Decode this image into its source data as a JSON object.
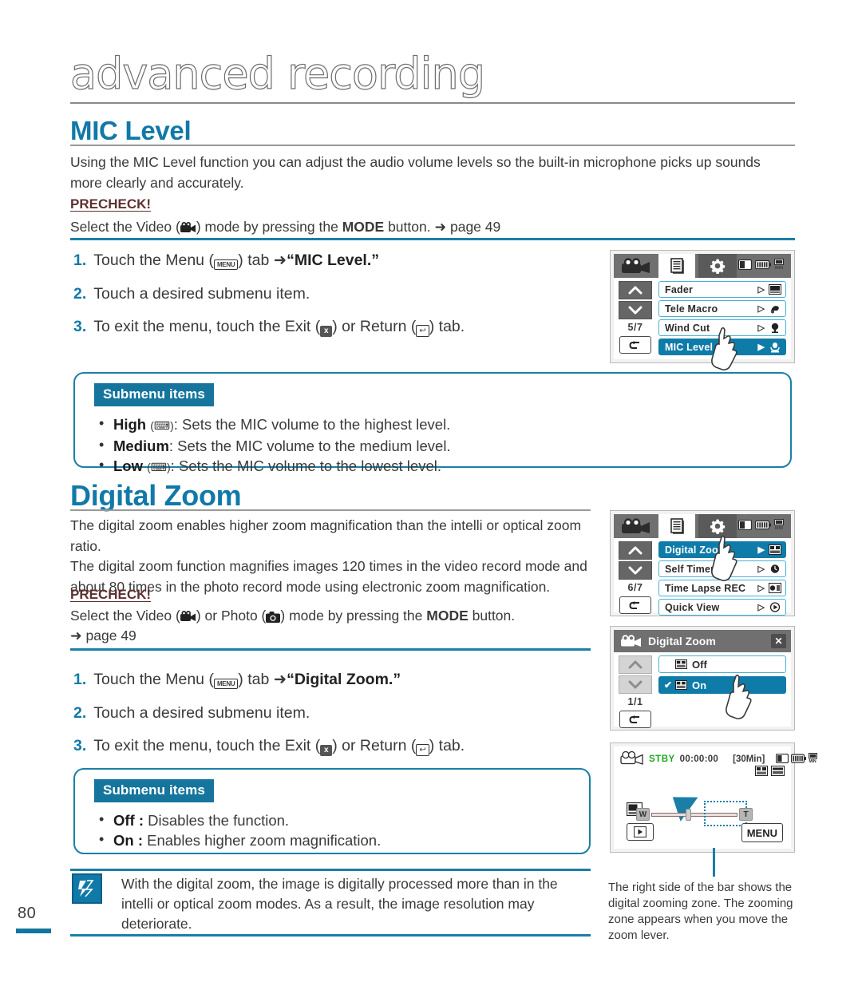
{
  "page": {
    "number": "80",
    "chapter_title": "advanced recording"
  },
  "sections": [
    {
      "heading": "MIC Level",
      "intro": "Using the MIC Level function you can adjust the audio volume levels so the built-in microphone picks up sounds more clearly and accurately.",
      "precheck_label": "PRECHECK!",
      "precheck_text_a": "Select the Video (",
      "precheck_text_b": ") mode by pressing the ",
      "precheck_mode": "MODE",
      "precheck_text_c": " button. ",
      "precheck_page": "➜ page 49",
      "steps": [
        {
          "num": "1.",
          "pre": "Touch the Menu (",
          "icon": "MENU",
          "mid": ") tab ➜",
          "bold": "“MIC Level.”",
          "post": ""
        },
        {
          "num": "2.",
          "pre": "Touch a desired submenu item.",
          "icon": "",
          "mid": "",
          "bold": "",
          "post": ""
        },
        {
          "num": "3.",
          "pre": "To exit the menu, touch the Exit (",
          "icon": "x",
          "mid": ") or Return (",
          "icon2": "↩",
          "bold": "",
          "post": ") tab."
        }
      ],
      "submenu_badge": "Submenu items",
      "submenu_items": [
        {
          "term": "High",
          "paren": "(🔊)",
          "desc": ": Sets the MIC volume to the highest level."
        },
        {
          "term": "Medium",
          "paren": "",
          "desc": ": Sets the MIC volume to the medium level."
        },
        {
          "term": "Low",
          "paren": "(🔉)",
          "desc": ": Sets the MIC volume to the lowest level."
        }
      ]
    },
    {
      "heading": "Digital Zoom",
      "intro_1": "The digital zoom enables higher zoom magnification than the intelli or optical zoom ratio.",
      "intro_2": "The digital zoom function magnifies images 120 times in the video record mode and about 80 times in the photo record mode using electronic zoom magnification.",
      "precheck_label": "PRECHECK!",
      "precheck_text_a": "Select the Video (",
      "precheck_text_b": ") or Photo (",
      "precheck_text_c": ") mode by pressing the ",
      "precheck_mode": "MODE",
      "precheck_text_d": " button.",
      "precheck_page": "➜ page 49",
      "steps": [
        {
          "num": "1.",
          "pre": "Touch the Menu (",
          "icon": "MENU",
          "mid": ") tab ➜",
          "bold": "“Digital Zoom.”"
        },
        {
          "num": "2.",
          "pre": "Touch a desired submenu item.",
          "icon": "",
          "mid": "",
          "bold": ""
        },
        {
          "num": "3.",
          "pre": "To exit the menu, touch the Exit (",
          "icon": "x",
          "mid": ") or Return (",
          "icon2": "↩",
          "post": ") tab."
        }
      ],
      "submenu_badge": "Submenu items",
      "submenu_items": [
        {
          "term": "Off :",
          "desc": " Disables the function."
        },
        {
          "term": "On :",
          "desc": " Enables higher zoom magnification."
        }
      ]
    }
  ],
  "note": {
    "icon": "note-pen-icon",
    "text": "With the digital zoom, the image is digitally processed more than in the intelli or optical zoom modes. As a result, the image resolution may deteriorate."
  },
  "screens": {
    "mic_menu": {
      "tabs": [
        "camcorder-icon",
        "document-icon",
        "gear-icon"
      ],
      "status_icons": [
        "card-icon",
        "battery-icon",
        "rec-mode-icon"
      ],
      "page_indicator": "5/7",
      "up": "⌃",
      "down": "⌄",
      "back": "↩",
      "rows": [
        {
          "label": "Fader",
          "selected": false,
          "arrow": "▷",
          "icon": "fader-icon"
        },
        {
          "label": "Tele Macro",
          "selected": false,
          "arrow": "▷",
          "icon": "tele-macro-icon"
        },
        {
          "label": "Wind Cut",
          "selected": false,
          "arrow": "▷",
          "icon": "wind-cut-icon"
        },
        {
          "label": "MIC Level",
          "selected": true,
          "arrow": "▶",
          "icon": "mic-level-icon"
        }
      ]
    },
    "zoom_menu": {
      "page_indicator": "6/7",
      "rows": [
        {
          "label": "Digital Zoom",
          "selected": true,
          "arrow": "▶",
          "icon": "digital-zoom-icon"
        },
        {
          "label": "Self Timer",
          "selected": false,
          "arrow": "▷",
          "icon": "self-timer-icon"
        },
        {
          "label": "Time Lapse REC",
          "selected": false,
          "arrow": "▷",
          "icon": "time-lapse-icon"
        },
        {
          "label": "Quick View",
          "selected": false,
          "arrow": "▷",
          "icon": "quick-view-icon"
        }
      ]
    },
    "zoom_dialog": {
      "title": "Digital Zoom",
      "close": "✕",
      "page_indicator": "1/1",
      "back": "↩",
      "options": [
        {
          "label": "Off",
          "selected": false,
          "check": ""
        },
        {
          "label": "On",
          "selected": true,
          "check": "✔"
        }
      ]
    },
    "rec_preview": {
      "mode_icon": "camcorder-icon",
      "status": "STBY",
      "timecode": "00:00:00",
      "rec_time": "[30Min]",
      "zoom_w": "W",
      "zoom_t": "T",
      "menu_button": "MENU",
      "play_button": "▶"
    }
  },
  "caption": {
    "text": "The right side of the bar shows the digital zooming zone. The zooming zone appears when you move the zoom lever."
  },
  "colors": {
    "accent_blue": "#1179a8",
    "rule_blue": "#1a7fa6",
    "badge_blue": "#16759c",
    "selected_row": "#0f7ba8",
    "stby_green": "#1aa81a"
  }
}
